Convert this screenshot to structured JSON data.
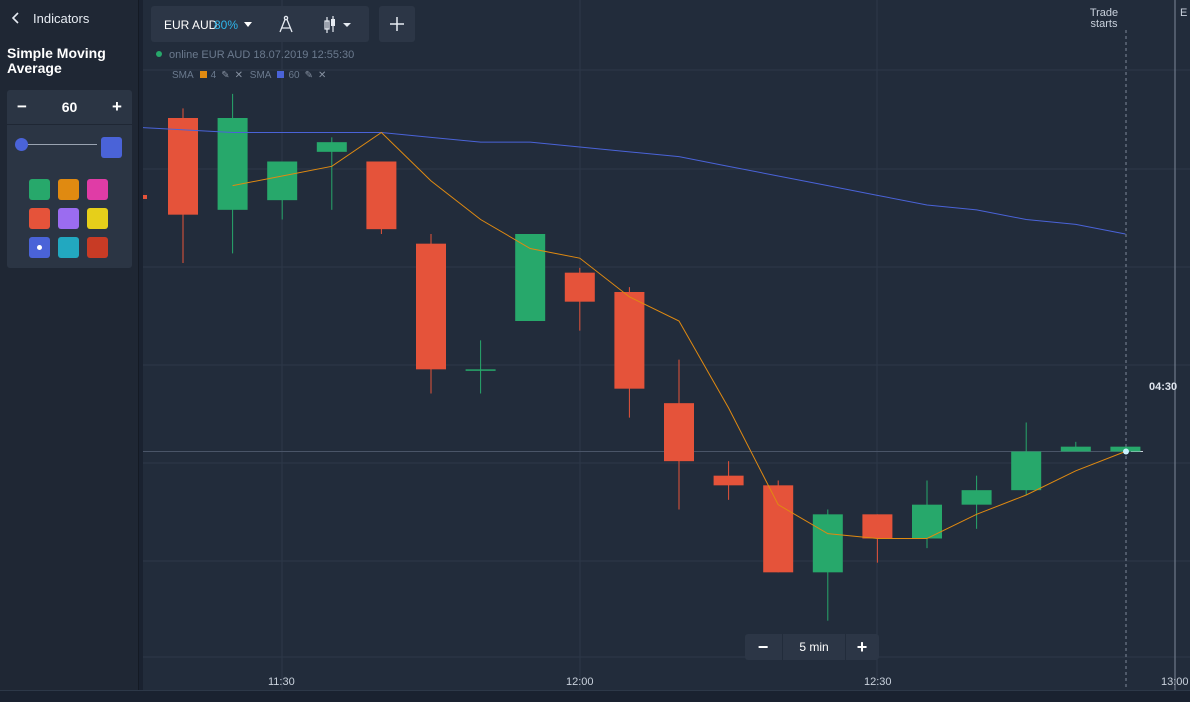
{
  "sidebar": {
    "header_title": "Indicators",
    "indicator_name": "Simple Moving Average",
    "period_value": "60",
    "minus_label": "−",
    "plus_label": "+",
    "selected_color": "#4a63d8",
    "palette": [
      "#27a86b",
      "#e08a11",
      "#e03ca6",
      "#e5533a",
      "#9b6cf0",
      "#e6cf1a",
      "#4a63d8",
      "#22a8c0",
      "#c83b25"
    ],
    "palette_selected_index": 6
  },
  "toolbar": {
    "asset": "EUR AUD",
    "payout": "80%",
    "draw_icon": "compass-icon",
    "chart_type_icon": "candlestick-icon",
    "add_label": "+"
  },
  "status": {
    "text": "online EUR AUD  18.07.2019 12:55:30"
  },
  "legend": {
    "items": [
      {
        "label": "SMA",
        "period": "4",
        "color": "#e08a11"
      },
      {
        "label": "SMA",
        "period": "60",
        "color": "#4a63d8"
      }
    ]
  },
  "trade_markers": {
    "trade_starts": "Trade starts",
    "expiration_partial": "E tr"
  },
  "timer": "04:30",
  "zoom": {
    "minus": "−",
    "value": "5 min",
    "plus": "+"
  },
  "x_axis": {
    "ticks": [
      "11:30",
      "12:00",
      "12:30",
      "13:00"
    ]
  },
  "chart_data": {
    "type": "candlestick",
    "interval": "5 min",
    "x_ticks": [
      "11:30",
      "12:00",
      "12:30",
      "13:00"
    ],
    "candles": [
      {
        "open": 0.78,
        "close": 0.98,
        "high": 1.0,
        "low": 0.68,
        "dir": "down"
      },
      {
        "open": 0.98,
        "close": 0.79,
        "high": 0.7,
        "low": 1.03,
        "dir": "up"
      },
      {
        "open": 0.81,
        "close": 0.89,
        "high": 0.77,
        "low": 0.89,
        "dir": "up"
      },
      {
        "open": 0.93,
        "close": 0.91,
        "high": 0.79,
        "low": 0.94,
        "dir": "up"
      },
      {
        "open": 0.89,
        "close": 0.75,
        "high": 0.87,
        "low": 0.74,
        "dir": "down"
      },
      {
        "open": 0.72,
        "close": 0.46,
        "high": 0.74,
        "low": 0.41,
        "dir": "down"
      },
      {
        "open": 0.46,
        "close": 0.46,
        "high": 0.52,
        "low": 0.41,
        "dir": "doji"
      },
      {
        "open": 0.56,
        "close": 0.74,
        "high": 0.74,
        "low": 0.56,
        "dir": "up"
      },
      {
        "open": 0.66,
        "close": 0.6,
        "high": 0.67,
        "low": 0.54,
        "dir": "down"
      },
      {
        "open": 0.62,
        "close": 0.42,
        "high": 0.63,
        "low": 0.36,
        "dir": "down"
      },
      {
        "open": 0.39,
        "close": 0.27,
        "high": 0.48,
        "low": 0.17,
        "dir": "down"
      },
      {
        "open": 0.24,
        "close": 0.22,
        "high": 0.27,
        "low": 0.19,
        "dir": "down"
      },
      {
        "open": 0.22,
        "close": 0.04,
        "high": 0.23,
        "low": 0.04,
        "dir": "down"
      },
      {
        "open": 0.04,
        "close": 0.16,
        "high": 0.17,
        "low": -0.06,
        "dir": "up"
      },
      {
        "open": 0.16,
        "close": 0.11,
        "high": 0.16,
        "low": 0.06,
        "dir": "down"
      },
      {
        "open": 0.11,
        "close": 0.18,
        "high": 0.23,
        "low": 0.09,
        "dir": "up"
      },
      {
        "open": 0.18,
        "close": 0.21,
        "high": 0.24,
        "low": 0.13,
        "dir": "up"
      },
      {
        "open": 0.21,
        "close": 0.29,
        "high": 0.35,
        "low": 0.2,
        "dir": "up"
      },
      {
        "open": 0.29,
        "close": 0.3,
        "high": 0.31,
        "low": 0.29,
        "dir": "up"
      },
      {
        "open": 0.29,
        "close": 0.3,
        "high": 0.3,
        "low": 0.29,
        "dir": "up"
      }
    ],
    "sma_fast": {
      "name": "SMA 4",
      "color": "#e08a11",
      "values": [
        null,
        0.84,
        0.86,
        0.88,
        0.95,
        0.85,
        0.77,
        0.71,
        0.69,
        0.61,
        0.56,
        0.38,
        0.18,
        0.12,
        0.11,
        0.11,
        0.16,
        0.2,
        0.25,
        0.29
      ]
    },
    "sma_slow": {
      "name": "SMA 60",
      "color": "#4a63d8",
      "values": [
        0.96,
        0.95,
        0.95,
        0.95,
        0.95,
        0.94,
        0.93,
        0.93,
        0.92,
        0.91,
        0.9,
        0.88,
        0.86,
        0.84,
        0.82,
        0.8,
        0.79,
        0.77,
        0.76,
        0.74
      ]
    },
    "current_price_level": 0.29,
    "colors": {
      "up": "#27a86b",
      "down": "#e5533a",
      "grid": "#2d3848",
      "price_line": "#4a5568"
    }
  }
}
